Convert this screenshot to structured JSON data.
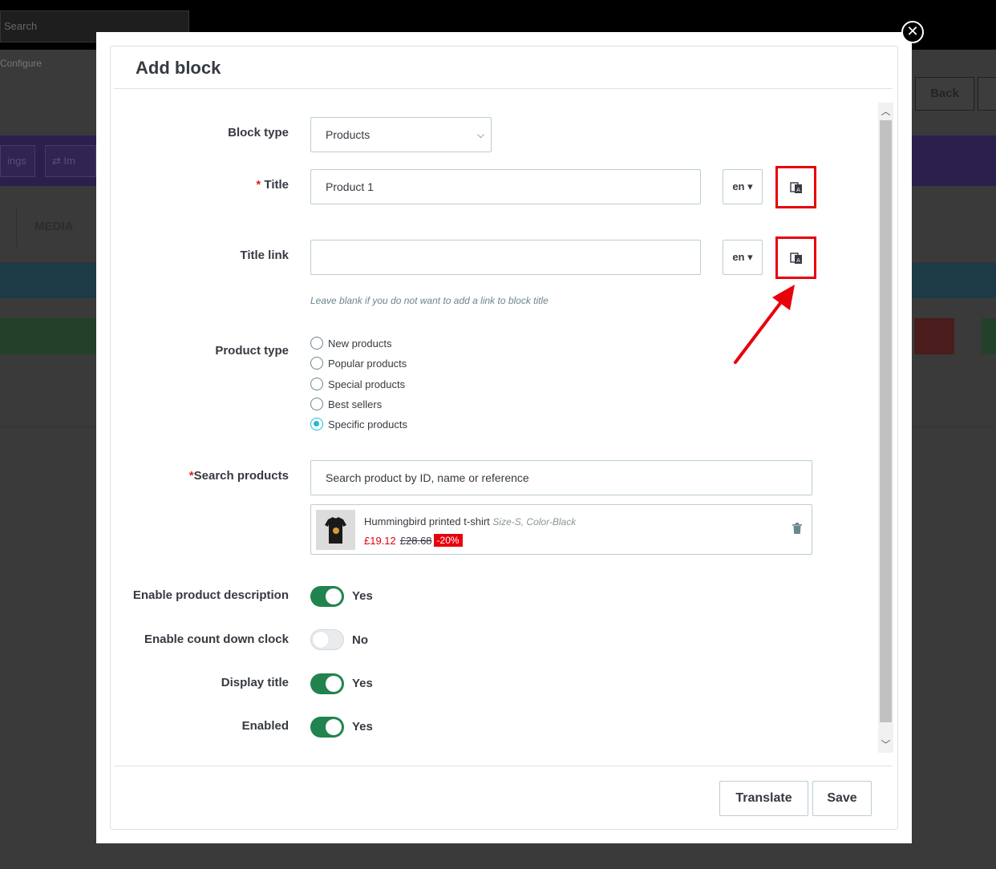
{
  "background": {
    "search_text": "Search",
    "breadcrumb": "Configure",
    "back_label": "Back",
    "nav_btn_1": "ings",
    "nav_btn_2": "⇄ Im",
    "tab_media": "MEDIA"
  },
  "modal": {
    "title": "Add block",
    "fields": {
      "block_type": {
        "label": "Block type",
        "value": "Products"
      },
      "title": {
        "required_mark": "*",
        "label": "Title",
        "value": "Product 1",
        "lang": "en"
      },
      "title_link": {
        "label": "Title link",
        "value": "",
        "lang": "en",
        "help": "Leave blank if you do not want to add a link to block title"
      },
      "product_type": {
        "label": "Product type",
        "options": [
          "New products",
          "Popular products",
          "Special products",
          "Best sellers",
          "Specific products"
        ],
        "selected": "Specific products"
      },
      "search_products": {
        "required_mark": "*",
        "label": "Search products",
        "placeholder": "Search product by ID, name or reference"
      },
      "selected_product": {
        "name": "Hummingbird printed t-shirt",
        "attributes": "Size-S, Color-Black",
        "price": "£19.12",
        "old_price": "£28.68",
        "discount": "-20%"
      },
      "enable_product_description": {
        "label": "Enable product description",
        "value": "Yes",
        "on": true
      },
      "enable_count_down_clock": {
        "label": "Enable count down clock",
        "value": "No",
        "on": false
      },
      "display_title": {
        "label": "Display title",
        "value": "Yes",
        "on": true
      },
      "enabled": {
        "label": "Enabled",
        "value": "Yes",
        "on": true
      }
    },
    "buttons": {
      "translate": "Translate",
      "save": "Save"
    }
  },
  "colors": {
    "highlight": "#e8000c",
    "toggle_on": "#21834d",
    "radio_selected": "#25b9d7",
    "price": "#e8000c"
  },
  "icons": [
    "close-icon",
    "translate-icon",
    "chevron-down-icon",
    "caret-down-icon",
    "trash-icon",
    "scroll-up-icon",
    "scroll-down-icon",
    "arrow-annotation"
  ]
}
